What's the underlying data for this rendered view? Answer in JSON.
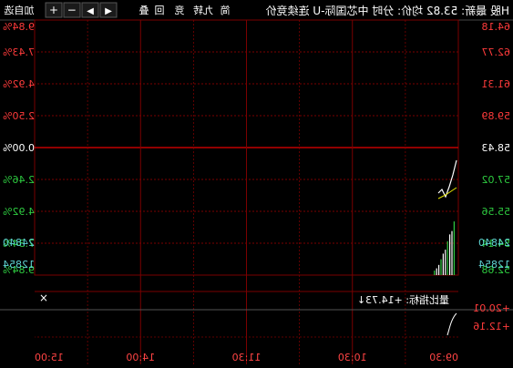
{
  "toolbar": {
    "items": [
      "◀",
      "▶",
      "−",
      "+",
      "加自选",
      "叠",
      "回",
      "竞",
      "九转",
      "简"
    ],
    "title_text": "H股 最新: 53.82 均价: 分时 中芯国际-U 连续竞价"
  },
  "price_axis": {
    "labels": [
      "64.18",
      "62.77",
      "61.31",
      "59.89",
      "58.43",
      "57.02",
      "55.56",
      "54.14",
      "52.68"
    ],
    "baseline": "58.43"
  },
  "pct_axis": {
    "labels": [
      "9.84%",
      "7.43%",
      "4.92%",
      "2.50%",
      "0.00%",
      "2.46%",
      "4.92%",
      "7.34%",
      "9.84%"
    ]
  },
  "volume_axis": {
    "right_labels": [
      "24840",
      "12854"
    ],
    "left_labels": [
      "24840",
      "12854"
    ]
  },
  "indicator": {
    "close_icon": "close-icon",
    "text": "量比指标: +14.73↓",
    "right_labels": [
      "+20.01",
      "+12.16"
    ]
  },
  "time_axis": {
    "labels": [
      "09:30",
      "10:30",
      "11:30",
      "14:00",
      "15:00"
    ]
  },
  "colors": {
    "background": "#000000",
    "grid": "#7a0000",
    "up": "#ff3b3b",
    "down": "#2ecc40",
    "volume_text": "#5fd3d3",
    "white": "#ffffff",
    "price_line": "#ffffff",
    "avg_line": "#e6e600"
  }
}
